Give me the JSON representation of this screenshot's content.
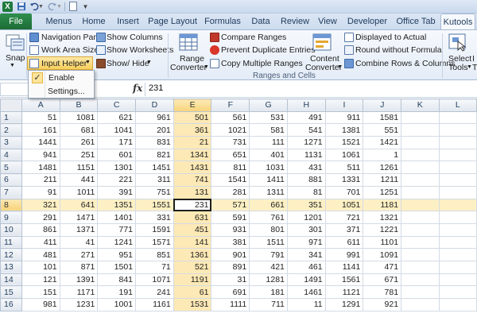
{
  "titlebar": {
    "excel_icon": "X"
  },
  "tabs": [
    {
      "label": "File"
    },
    {
      "label": "Menus"
    },
    {
      "label": "Home"
    },
    {
      "label": "Insert"
    },
    {
      "label": "Page Layout"
    },
    {
      "label": "Formulas"
    },
    {
      "label": "Data"
    },
    {
      "label": "Review"
    },
    {
      "label": "View"
    },
    {
      "label": "Developer"
    },
    {
      "label": "Office Tab"
    },
    {
      "label": "Kutools"
    }
  ],
  "ribbon": {
    "snap": "Snap",
    "navigation_pane": "Navigation Pane",
    "work_area_size": "Work Area Size",
    "input_helper": "Input Helper",
    "show_columns": "Show Columns",
    "show_worksheets": "Show Worksheets",
    "show_hide": "Show/ Hide",
    "range_converter_1": "Range",
    "range_converter_2": "Converter",
    "compare_ranges": "Compare Ranges",
    "prevent_duplicate_entries": "Prevent Duplicate Entries",
    "copy_multiple_ranges": "Copy Multiple Ranges",
    "content_converter_1": "Content",
    "content_converter_2": "Converter",
    "displayed_to_actual": "Displayed to Actual",
    "round_without_formula": "Round without Formula",
    "combine_rows_columns": "Combine Rows & Columns",
    "select_tools_1": "Select",
    "select_tools_2": "Tools",
    "insert_tools_1": "I",
    "insert_tools_2": "T",
    "group_label": "Ranges and Cells"
  },
  "dropdown": {
    "check": "✓",
    "enable": "Enable",
    "settings": "Settings..."
  },
  "formula": {
    "fx": "fx",
    "value": "231"
  },
  "grid": {
    "columns": [
      "A",
      "B",
      "C",
      "D",
      "E",
      "F",
      "G",
      "H",
      "I",
      "J",
      "K",
      "L"
    ],
    "rows": [
      [
        "51",
        "1081",
        "621",
        "961",
        "501",
        "561",
        "531",
        "491",
        "911",
        "1581",
        "",
        ""
      ],
      [
        "161",
        "681",
        "1041",
        "201",
        "361",
        "1021",
        "581",
        "541",
        "1381",
        "551",
        "",
        ""
      ],
      [
        "1441",
        "261",
        "171",
        "831",
        "21",
        "731",
        "111",
        "1271",
        "1521",
        "1421",
        "",
        ""
      ],
      [
        "941",
        "251",
        "601",
        "821",
        "1341",
        "651",
        "401",
        "1131",
        "1061",
        "1",
        "",
        ""
      ],
      [
        "1481",
        "1151",
        "1301",
        "1451",
        "1431",
        "811",
        "1031",
        "431",
        "511",
        "1261",
        "",
        ""
      ],
      [
        "211",
        "441",
        "221",
        "311",
        "741",
        "1541",
        "1411",
        "881",
        "1331",
        "1211",
        "",
        ""
      ],
      [
        "91",
        "1011",
        "391",
        "751",
        "131",
        "281",
        "1311",
        "81",
        "701",
        "1251",
        "",
        ""
      ],
      [
        "321",
        "641",
        "1351",
        "1551",
        "231",
        "571",
        "661",
        "351",
        "1051",
        "1181",
        "",
        ""
      ],
      [
        "291",
        "1471",
        "1401",
        "331",
        "631",
        "591",
        "761",
        "1201",
        "721",
        "1321",
        "",
        ""
      ],
      [
        "861",
        "1371",
        "771",
        "1591",
        "451",
        "931",
        "801",
        "301",
        "371",
        "1221",
        "",
        ""
      ],
      [
        "411",
        "41",
        "1241",
        "1571",
        "141",
        "381",
        "1511",
        "971",
        "611",
        "1101",
        "",
        ""
      ],
      [
        "481",
        "271",
        "951",
        "851",
        "1361",
        "901",
        "791",
        "341",
        "991",
        "1091",
        "",
        ""
      ],
      [
        "101",
        "871",
        "1501",
        "71",
        "521",
        "891",
        "421",
        "461",
        "1141",
        "471",
        "",
        ""
      ],
      [
        "121",
        "1391",
        "841",
        "1071",
        "1191",
        "31",
        "1281",
        "1491",
        "1561",
        "671",
        "",
        ""
      ],
      [
        "151",
        "1171",
        "191",
        "241",
        "61",
        "691",
        "181",
        "1461",
        "1121",
        "781",
        "",
        ""
      ],
      [
        "981",
        "1231",
        "1001",
        "1161",
        "1531",
        "1111",
        "711",
        "11",
        "1291",
        "921",
        "",
        ""
      ]
    ],
    "active_row": 8,
    "active_col": "E"
  }
}
